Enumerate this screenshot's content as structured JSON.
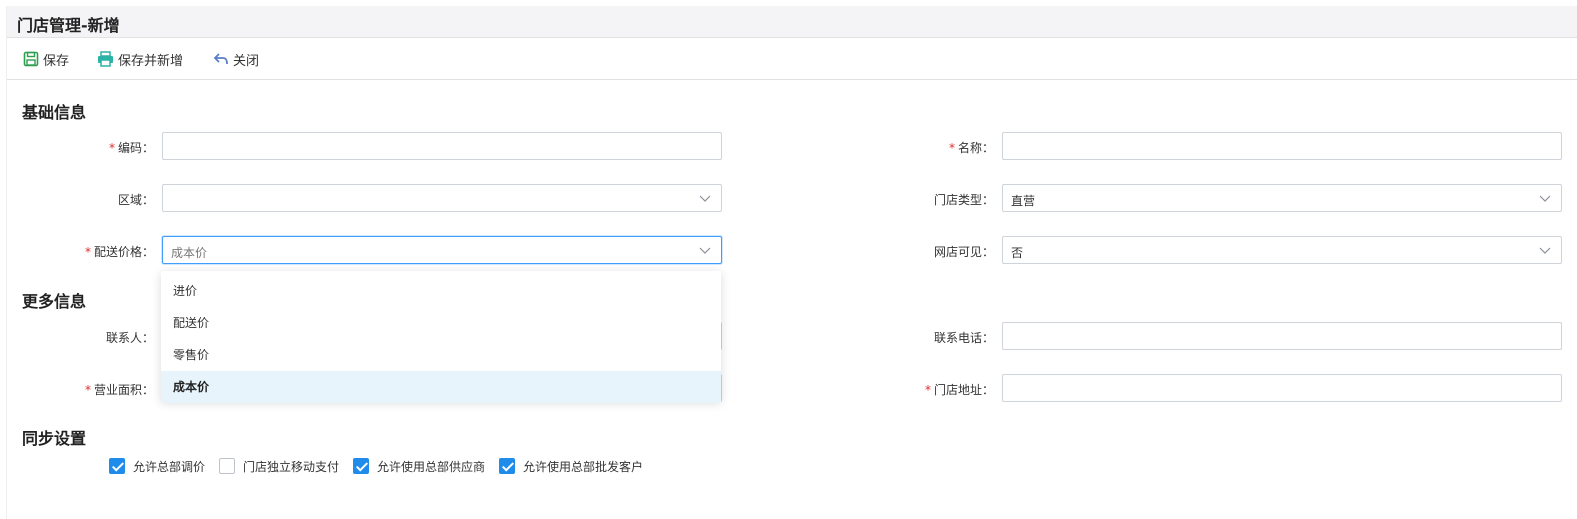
{
  "window": {
    "title": "门店管理-新增"
  },
  "toolbar": {
    "save": "保存",
    "save_and_new": "保存并新增",
    "close": "关闭"
  },
  "sections": {
    "basic": "基础信息",
    "more": "更多信息",
    "sync": "同步设置"
  },
  "fields": {
    "code": {
      "label": "编码：",
      "value": ""
    },
    "name": {
      "label": "名称：",
      "value": ""
    },
    "region": {
      "label": "区域：",
      "value": ""
    },
    "store_type": {
      "label": "门店类型：",
      "value": "直营"
    },
    "delivery_price": {
      "label": "配送价格：",
      "value": "成本价"
    },
    "online_visible": {
      "label": "网店可见：",
      "value": "否"
    },
    "contact": {
      "label": "联系人：",
      "value": ""
    },
    "phone": {
      "label": "联系电话：",
      "value": ""
    },
    "area": {
      "label": "营业面积：",
      "value": ""
    },
    "address": {
      "label": "门店地址：",
      "value": ""
    }
  },
  "dropdown": {
    "options": [
      "进价",
      "配送价",
      "零售价",
      "成本价"
    ],
    "selected": "成本价"
  },
  "sync": {
    "items": [
      {
        "label": "允许总部调价",
        "checked": true
      },
      {
        "label": "门店独立移动支付",
        "checked": false
      },
      {
        "label": "允许使用总部供应商",
        "checked": true
      },
      {
        "label": "允许使用总部批发客户",
        "checked": true
      }
    ]
  },
  "colors": {
    "accent": "#1f8ceb",
    "required": "#e02b2b",
    "save_icon": "#2e9e4f",
    "print_icon": "#2bb3a6",
    "undo_icon": "#5b7fc7"
  }
}
